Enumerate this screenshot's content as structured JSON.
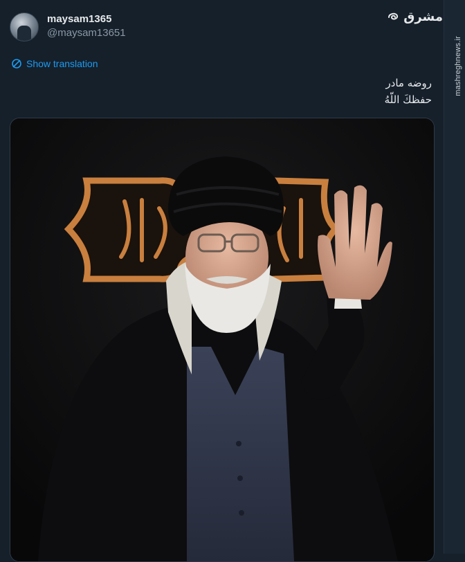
{
  "author": {
    "display_name": "maysam1365",
    "handle": "@maysam13651"
  },
  "translate": {
    "label": "Show translation"
  },
  "tweet": {
    "line1": "روضه مادر",
    "line2": "حفظكَ اللّهُ"
  },
  "watermark": {
    "brand": "مشرق",
    "site": "mashreghnews.ir"
  },
  "colors": {
    "background": "#15202b",
    "link": "#1d9bf0",
    "banner_frame": "#c97f3e"
  }
}
